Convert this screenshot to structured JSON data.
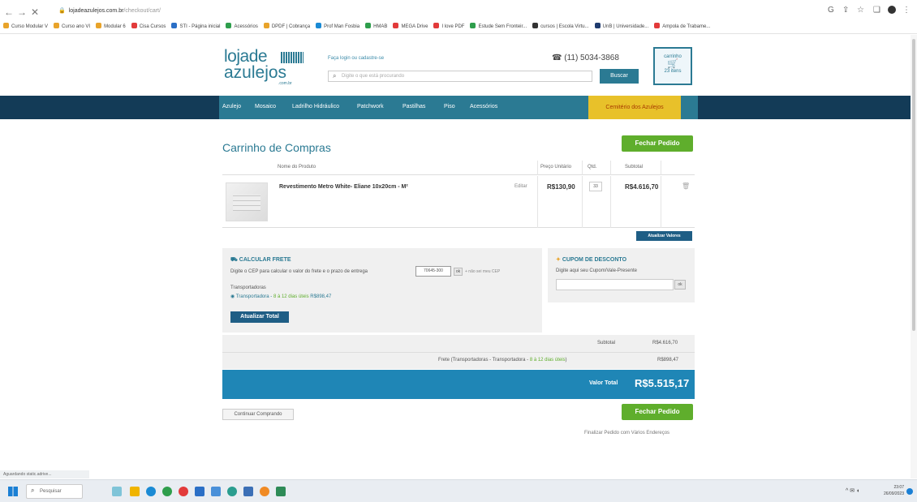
{
  "browser": {
    "address_host": "lojadeazulejos.com.br",
    "address_path": "/checkout/cart/",
    "bookmarks": [
      "Curso Modular V",
      "Curso ano VI",
      "Modular 6",
      "Cisa Cursos",
      "STI - Página inicial",
      "Acessórios",
      "DPDF | Cobrança",
      "Prof Man Fosbia",
      "HMAB",
      "MEGA Drive",
      "I love PDF",
      "Estude Sem Fronteir...",
      "cursos | Escola Virtu...",
      "UnB | Universidade...",
      "Ampola de Trabame..."
    ]
  },
  "site": {
    "logo_line1": "lojade",
    "logo_line2": "azulejos",
    "logo_domain": ".com.br",
    "login_text": "Faça login ou cadastre-se",
    "search_placeholder": "Digite o que está procurando",
    "phone": "(11) 5034-3868",
    "search_button": "Buscar",
    "cart_line1": "carrinho",
    "cart_line2": "23 itens",
    "menu": [
      "Azulejo",
      "Mosaico",
      "Ladrilho Hidráulico",
      "Patchwork",
      "Pastilhas",
      "Piso",
      "Acessórios",
      "Cemitério dos Azulejos"
    ]
  },
  "cart": {
    "title": "Carrinho de Compras",
    "checkout_button": "Fechar Pedido",
    "columns": {
      "name": "Nome do Produto",
      "unit_price": "Preço Unitário",
      "qty": "Qtd.",
      "subtotal": "Subtotal"
    },
    "product": {
      "name": "Revestimento Metro White- Eliane 10x20cm - M²",
      "edit": "Editar",
      "unit_price": "R$130,90",
      "qty": "33",
      "subtotal": "R$4.616,70"
    },
    "update_values": "Atualizar Valores"
  },
  "shipping": {
    "title": "CALCULAR FRETE",
    "instructions": "Digite o CEP para calcular o valor do frete e o prazo de entrega",
    "cep_value": "70645-300",
    "ok": "ok",
    "cep_link": "+ não sei meu CEP",
    "carriers_label": "Transportadoras",
    "option_text": "Transportadora - ",
    "option_days": "8 à 12 dias úteis",
    "option_price": " R$898,47",
    "update_total": "Atualizar Total"
  },
  "coupon": {
    "title": "CUPOM DE DESCONTO",
    "instructions": "Digite aqui seu Cupom/Vale-Presente",
    "ok": "ok"
  },
  "totals": {
    "subtotal_label": "Subtotal",
    "subtotal_value": "R$4.616,70",
    "freight_label": "Frete (Transportadoras - Transportadora - ",
    "freight_days": "8 à 12 dias úteis",
    "freight_close": ")",
    "freight_value": "R$898,47",
    "total_label": "Valor Total",
    "total_value": "R$5.515,17"
  },
  "footer_actions": {
    "continue": "Continuar Comprando",
    "checkout": "Fechar Pedido",
    "multi_address": "Finalizar Pedido com Vários Endereços"
  },
  "status_bar": "Aguardando static.adrive...",
  "taskbar": {
    "search_placeholder": "Pesquisar",
    "time": "23:07",
    "date": "26/09/2023"
  }
}
